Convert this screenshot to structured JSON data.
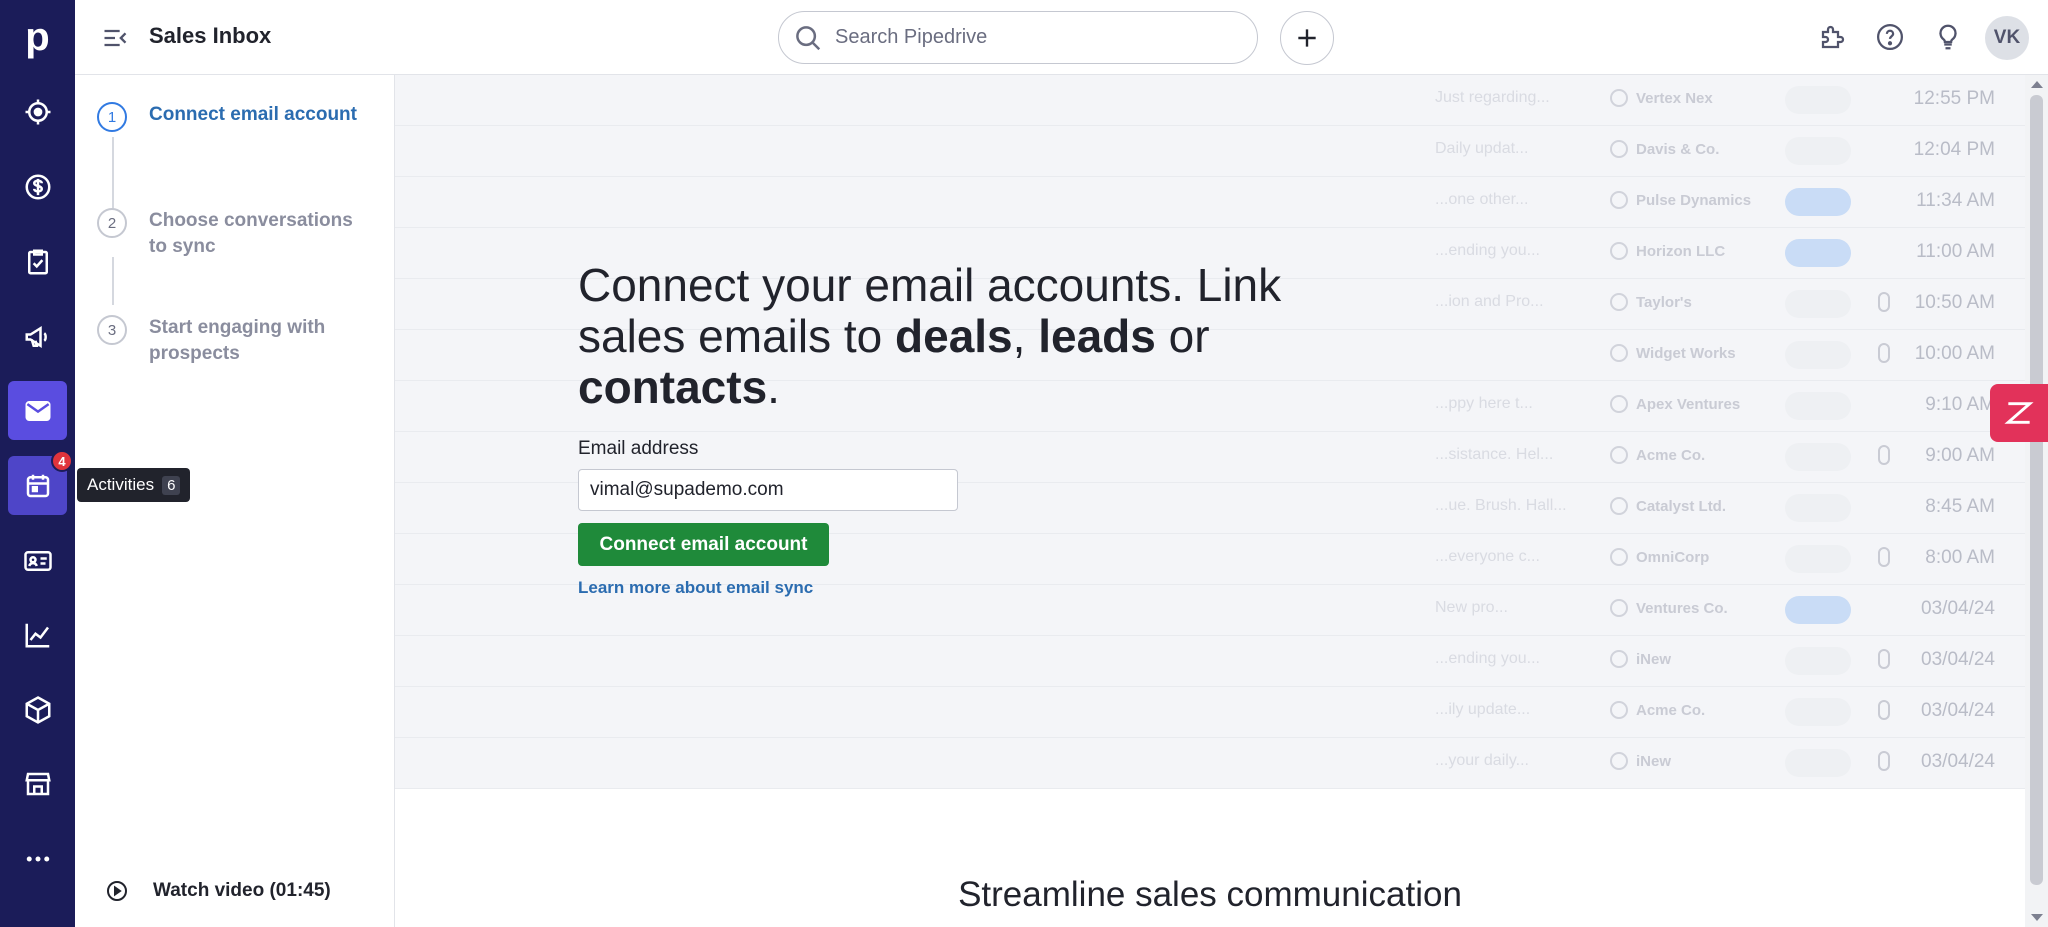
{
  "app": {
    "logo_letter": "p",
    "title": "Sales Inbox"
  },
  "search": {
    "placeholder": "Search Pipedrive"
  },
  "user": {
    "initials": "VK"
  },
  "rail": {
    "items": [
      {
        "icon": "target-icon",
        "label": "Leads"
      },
      {
        "icon": "dollar-icon",
        "label": "Deals"
      },
      {
        "icon": "clipboard-check-icon",
        "label": "Projects"
      },
      {
        "icon": "megaphone-icon",
        "label": "Campaigns"
      },
      {
        "icon": "mail-icon",
        "label": "Mail",
        "active": true
      },
      {
        "icon": "calendar-icon",
        "label": "Activities",
        "badge": "4"
      },
      {
        "icon": "contact-card-icon",
        "label": "Contacts"
      },
      {
        "icon": "chart-line-icon",
        "label": "Insights"
      },
      {
        "icon": "box-icon",
        "label": "Products"
      },
      {
        "icon": "store-icon",
        "label": "Marketplace"
      },
      {
        "icon": "more-icon",
        "label": "More"
      }
    ],
    "activities_badge": "4",
    "tooltip": {
      "label": "Activities",
      "count": "6"
    }
  },
  "steps": [
    {
      "num": "1",
      "label": "Connect email account"
    },
    {
      "num": "2",
      "label": "Choose conversations to sync"
    },
    {
      "num": "3",
      "label": "Start engaging with prospects"
    }
  ],
  "watch_video": "Watch video (01:45)",
  "hero": {
    "headline_part1": "Connect your email accounts. Link sales emails to ",
    "deals": "deals",
    "comma": ", ",
    "leads": "leads",
    "or": " or ",
    "contacts": "contacts",
    "period": ".",
    "email_label": "Email address",
    "email_value": "vimal@supademo.com",
    "connect_button": "Connect email account",
    "learn_more": "Learn more about email sync"
  },
  "streamline": "Streamline sales communication",
  "ghost_rows": [
    {
      "subj": "Just regarding...",
      "org": "Vertex Nex",
      "time": "12:55 PM",
      "blue": false,
      "clip": false
    },
    {
      "subj": "Daily updat...",
      "org": "Davis & Co.",
      "time": "12:04 PM",
      "blue": false,
      "clip": false
    },
    {
      "subj": "...one other...",
      "org": "Pulse Dynamics",
      "time": "11:34 AM",
      "blue": true,
      "clip": false
    },
    {
      "subj": "...ending you...",
      "org": "Horizon LLC",
      "time": "11:00 AM",
      "blue": true,
      "clip": false
    },
    {
      "subj": "...ion and Pro...",
      "org": "Taylor's",
      "time": "10:50 AM",
      "blue": false,
      "clip": true
    },
    {
      "subj": "",
      "org": "Widget Works",
      "time": "10:00 AM",
      "blue": false,
      "clip": true
    },
    {
      "subj": "...ppy here t...",
      "org": "Apex Ventures",
      "time": "9:10 AM",
      "blue": false,
      "clip": false
    },
    {
      "subj": "...sistance. Hel...",
      "org": "Acme Co.",
      "time": "9:00 AM",
      "blue": false,
      "clip": true
    },
    {
      "subj": "...ue. Brush. Hall...",
      "org": "Catalyst Ltd.",
      "time": "8:45 AM",
      "blue": false,
      "clip": false
    },
    {
      "subj": "...everyone c...",
      "org": "OmniCorp",
      "time": "8:00 AM",
      "blue": false,
      "clip": true
    },
    {
      "subj": "New pro...",
      "org": "Ventures Co.",
      "time": "03/04/24",
      "blue": true,
      "clip": false
    },
    {
      "subj": "...ending you...",
      "org": "iNew",
      "time": "03/04/24",
      "blue": false,
      "clip": true
    },
    {
      "subj": "...ily update...",
      "org": "Acme Co.",
      "time": "03/04/24",
      "blue": false,
      "clip": true
    },
    {
      "subj": "...your daily...",
      "org": "iNew",
      "time": "03/04/24",
      "blue": false,
      "clip": true
    }
  ]
}
